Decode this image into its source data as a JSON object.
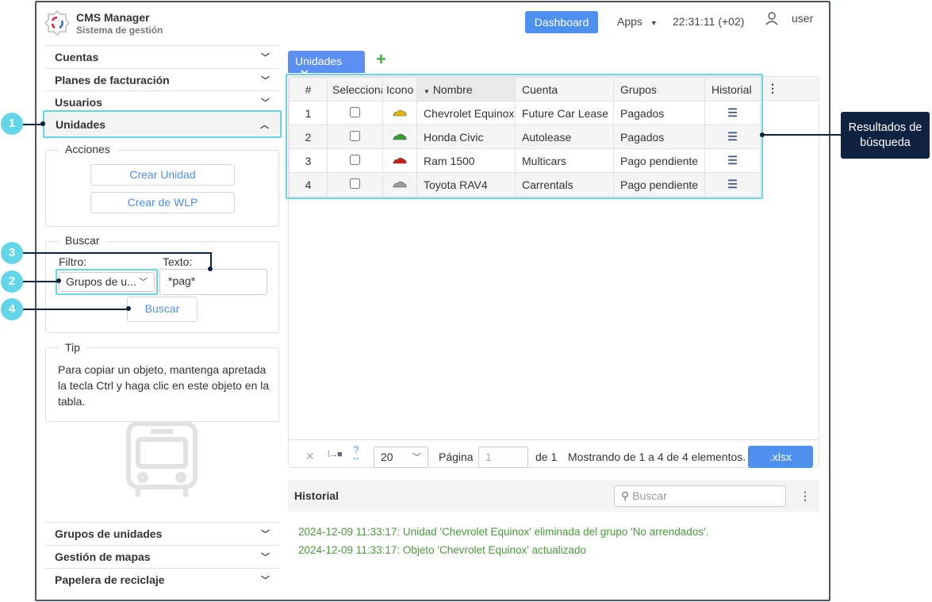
{
  "header": {
    "app_title": "CMS Manager",
    "app_subtitle": "Sistema de gestión",
    "dashboard_label": "Dashboard",
    "apps_label": "Apps",
    "clock": "22:31:11 (+02)",
    "user": "user"
  },
  "sidebar": {
    "items": [
      {
        "label": "Cuentas"
      },
      {
        "label": "Planes de facturación"
      },
      {
        "label": "Usuarios"
      },
      {
        "label": "Unidades"
      }
    ],
    "bottom_items": [
      {
        "label": "Grupos de unidades"
      },
      {
        "label": "Gestión de mapas"
      },
      {
        "label": "Papelera de reciclaje"
      }
    ],
    "actions": {
      "title": "Acciones",
      "create_unit": "Crear Unidad",
      "create_wlp": "Crear de WLP"
    },
    "search": {
      "title": "Buscar",
      "filter_label": "Filtro:",
      "filter_value": "Grupos de u...",
      "text_label": "Texto:",
      "text_value": "*pag*",
      "button": "Buscar"
    },
    "tip": {
      "title": "Tip",
      "text": "Para copiar un objeto, mantenga apretada la tecla Ctrl y haga clic en este objeto en la tabla."
    }
  },
  "tabs": [
    {
      "label": "Unidades"
    }
  ],
  "table": {
    "headers": [
      "#",
      "Seleccionar",
      "Icono",
      "Nombre",
      "Cuenta",
      "Grupos",
      "Historial"
    ],
    "rows": [
      {
        "n": "1",
        "name": "Chevrolet Equinox",
        "account": "Future Car Lease",
        "group": "Pagados",
        "color": "#e0b800"
      },
      {
        "n": "2",
        "name": "Honda Civic",
        "account": "Autolease",
        "group": "Pagados",
        "color": "#3a9a3a"
      },
      {
        "n": "3",
        "name": "Ram 1500",
        "account": "Multicars",
        "group": "Pago pendiente",
        "color": "#c82020"
      },
      {
        "n": "4",
        "name": "Toyota RAV4",
        "account": "Carrentals",
        "group": "Pago pendiente",
        "color": "#9a9a9a"
      }
    ]
  },
  "pager": {
    "page_size": "20",
    "page_label": "Página",
    "page_value": "1",
    "of_label": "de 1",
    "showing": "Mostrando de 1 a 4 de 4 elementos.",
    "export": ".xlsx"
  },
  "history": {
    "title": "Historial",
    "search_placeholder": "Buscar",
    "entries": [
      "2024-12-09 11:33:17: Unidad 'Chevrolet Equinox' eliminada del grupo 'No arrendados'.",
      "2024-12-09 11:33:17: Objeto 'Chevrolet Equinox' actualizado"
    ]
  },
  "callouts": {
    "c1": "1",
    "c2": "2",
    "c3": "3",
    "c4": "4",
    "results": "Resultados de búsqueda"
  }
}
